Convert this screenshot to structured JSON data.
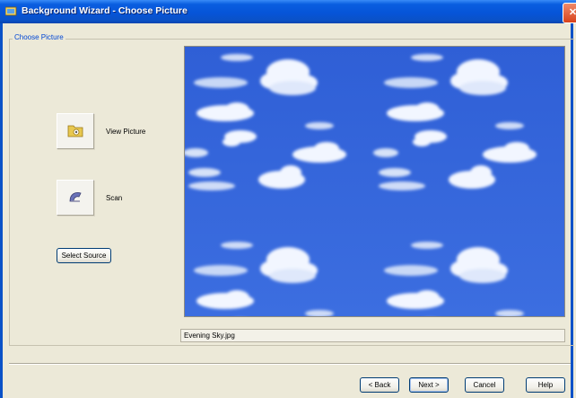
{
  "window": {
    "title": "Background Wizard - Choose Picture",
    "close_glyph": "✕"
  },
  "group": {
    "label": "Choose Picture"
  },
  "actions": {
    "view_picture": {
      "label": "View Picture",
      "icon": "folder-icon"
    },
    "scan": {
      "label": "Scan",
      "icon": "scanner-icon"
    },
    "select_source": "Select Source"
  },
  "preview": {
    "filename": "Evening Sky.jpg"
  },
  "footer": {
    "back": "< Back",
    "next": "Next >",
    "cancel": "Cancel",
    "help": "Help"
  }
}
